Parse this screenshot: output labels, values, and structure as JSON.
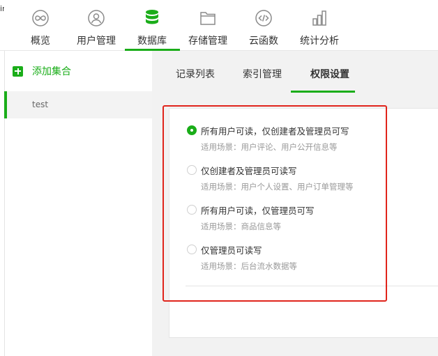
{
  "topbar": {
    "corner_text": "ir",
    "nav": [
      {
        "label": "概览",
        "icon": "infinity-icon"
      },
      {
        "label": "用户管理",
        "icon": "user-icon"
      },
      {
        "label": "数据库",
        "icon": "database-icon",
        "active": true
      },
      {
        "label": "存储管理",
        "icon": "folder-icon"
      },
      {
        "label": "云函数",
        "icon": "code-icon"
      },
      {
        "label": "统计分析",
        "icon": "bar-chart-icon"
      }
    ]
  },
  "sidebar": {
    "add_label": "添加集合",
    "collections": [
      "test"
    ]
  },
  "tabs": [
    {
      "label": "记录列表"
    },
    {
      "label": "索引管理"
    },
    {
      "label": "权限设置",
      "active": true
    }
  ],
  "permissions": {
    "options": [
      {
        "title": "所有用户可读，仅创建者及管理员可写",
        "desc": "适用场景：用户评论、用户公开信息等",
        "checked": true
      },
      {
        "title": "仅创建者及管理员可读写",
        "desc": "适用场景：用户个人设置、用户订单管理等",
        "checked": false
      },
      {
        "title": "所有用户可读，仅管理员可写",
        "desc": "适用场景：商品信息等",
        "checked": false
      },
      {
        "title": "仅管理员可读写",
        "desc": "适用场景：后台流水数据等",
        "checked": false
      }
    ]
  },
  "colors": {
    "accent": "#1aad19",
    "highlight": "#e0241b"
  }
}
